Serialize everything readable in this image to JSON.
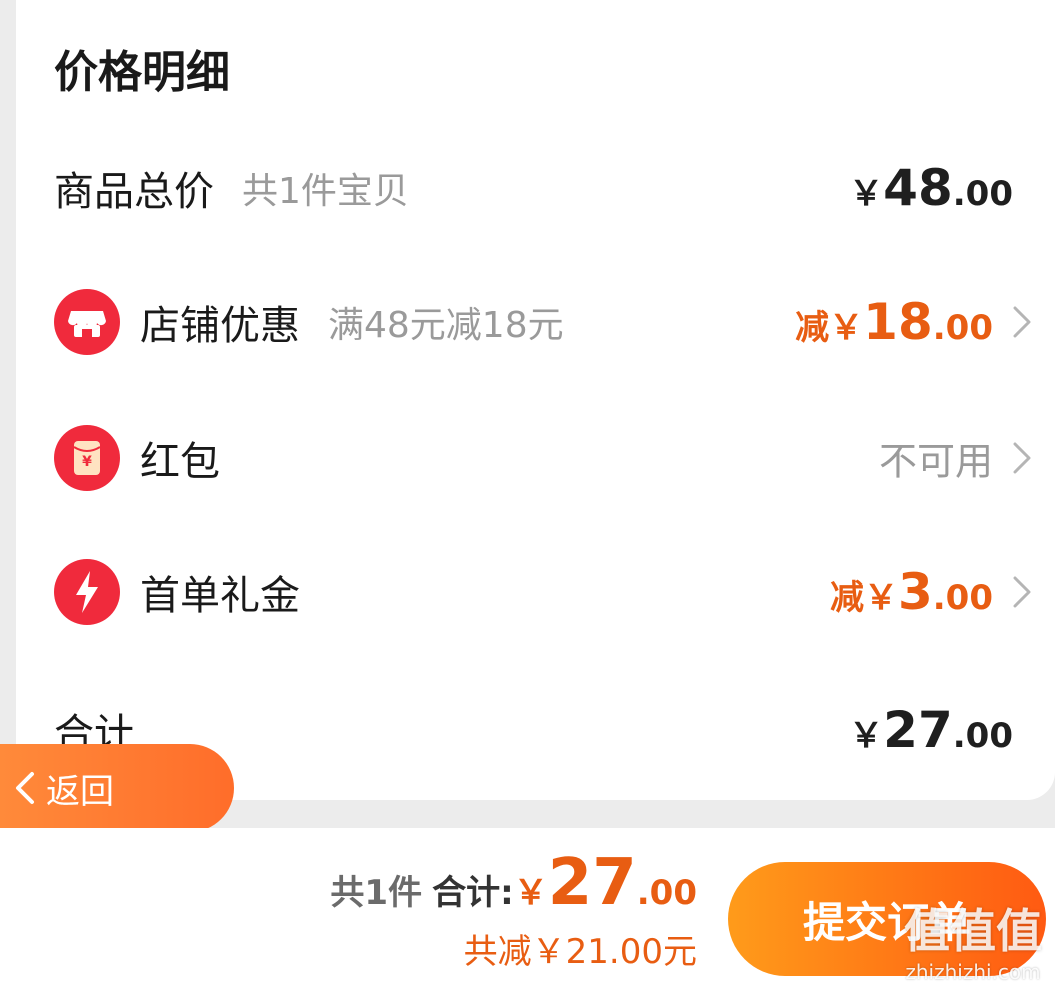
{
  "price_detail": {
    "title": "价格明细",
    "rows": {
      "goods_total": {
        "label": "商品总价",
        "sub": "共1件宝贝",
        "yen": "￥",
        "int": "48",
        "dec": ".00"
      },
      "shop_discount": {
        "label": "店铺优惠",
        "sub": "满48元减18元",
        "prefix": "减",
        "yen": "￥",
        "int": "18",
        "dec": ".00",
        "icon": "shop-icon"
      },
      "red_packet": {
        "label": "红包",
        "status": "不可用",
        "icon": "red-packet-icon"
      },
      "first_order_gift": {
        "label": "首单礼金",
        "prefix": "减",
        "yen": "￥",
        "int": "3",
        "dec": ".00",
        "icon": "lightning-icon"
      },
      "total": {
        "label": "合计",
        "yen": "￥",
        "int": "27",
        "dec": ".00"
      }
    }
  },
  "back_button": {
    "label": "返回"
  },
  "bottom_bar": {
    "count": "共1件",
    "total_label": "合计:",
    "yen": "￥",
    "total_int": "27",
    "total_dec": ".00",
    "savings": "共减￥21.00元",
    "submit_label": "提交订单"
  },
  "watermark": {
    "big": "值值值",
    "small": "zhizhizhi.com"
  },
  "colors": {
    "accent": "#e85d12",
    "button_start": "#ff9b1a",
    "button_end": "#ff5a12",
    "icon_red": "#f02a3c"
  }
}
